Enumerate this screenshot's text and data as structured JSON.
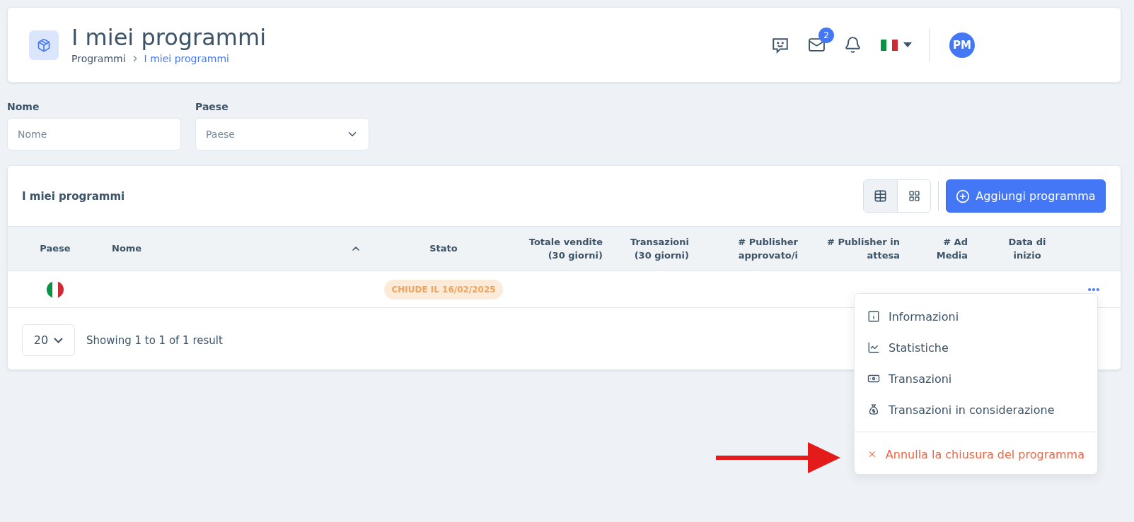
{
  "header": {
    "title": "I miei programmi",
    "breadcrumb": [
      {
        "label": "Programmi",
        "current": false
      },
      {
        "label": "I miei programmi",
        "current": true
      }
    ],
    "messages_badge": "2",
    "avatar": "PM"
  },
  "filters": [
    {
      "kind": "text",
      "label": "Nome",
      "placeholder": "Nome"
    },
    {
      "kind": "select",
      "label": "Paese",
      "placeholder": "Paese"
    }
  ],
  "table": {
    "title": "I miei programmi",
    "view_modes": [
      {
        "kind": "table",
        "selected": true
      },
      {
        "kind": "grid",
        "selected": false
      }
    ],
    "add_button": "Aggiungi programma",
    "columns": [
      {
        "label": "Paese"
      },
      {
        "label": "Nome",
        "sorted": true
      },
      {
        "label": "Stato"
      },
      {
        "label": "Totale vendite\n(30 giorni)"
      },
      {
        "label": "Transazioni\n(30 giorni)"
      },
      {
        "label": "# Publisher\napprovato/i"
      },
      {
        "label": "# Publisher in\nattesa"
      },
      {
        "label": "# Ad\nMedia"
      },
      {
        "label": "Data di\ninizio"
      }
    ],
    "rows": [
      {
        "status": "CHIUDE IL 16/02/2025"
      }
    ],
    "page_size": "20",
    "summary": "Showing 1 to 1 of 1 result"
  },
  "row_menu": [
    {
      "kind": "info",
      "label": "Informazioni"
    },
    {
      "kind": "stats",
      "label": "Statistiche"
    },
    {
      "kind": "money",
      "label": "Transazioni"
    },
    {
      "kind": "bag",
      "label": "Transazioni in considerazione"
    },
    {
      "kind": "danger",
      "label": "Annulla la chiusura del programma"
    }
  ]
}
